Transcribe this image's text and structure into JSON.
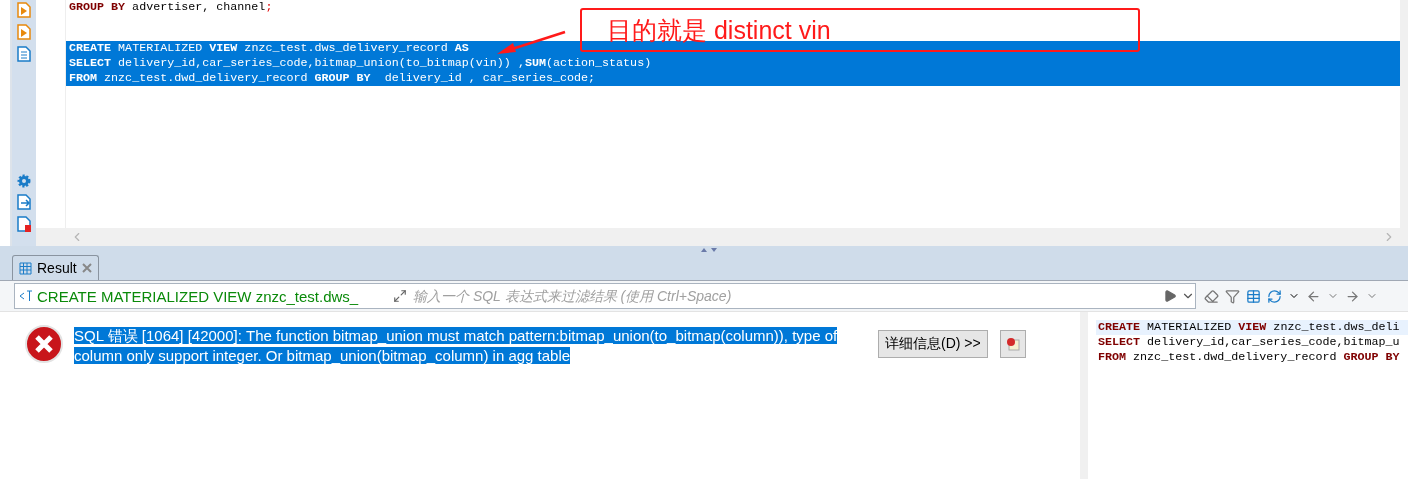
{
  "editor": {
    "previous_lines": [
      {
        "selected": false,
        "tokens": [
          {
            "kind": "keyword",
            "text": "GROUP BY"
          },
          {
            "kind": "text",
            "text": " advertiser, channel"
          },
          {
            "kind": "punct",
            "text": ";"
          }
        ]
      }
    ],
    "lines": [
      {
        "selected": true,
        "tokens": [
          {
            "kind": "keyword",
            "text": "CREATE"
          },
          {
            "kind": "text",
            "text": " MATERIALIZED "
          },
          {
            "kind": "keyword",
            "text": "VIEW"
          },
          {
            "kind": "text",
            "text": " znzc_test.dws_delivery_record "
          },
          {
            "kind": "keyword",
            "text": "AS"
          }
        ]
      },
      {
        "selected": true,
        "tokens": [
          {
            "kind": "keyword",
            "text": "SELECT"
          },
          {
            "kind": "text",
            "text": " delivery_id,car_series_code,bitmap_union(to_bitmap(vin)) ,"
          },
          {
            "kind": "keyword",
            "text": "SUM"
          },
          {
            "kind": "text",
            "text": "(action_status)"
          }
        ]
      },
      {
        "selected": true,
        "tokens": [
          {
            "kind": "keyword",
            "text": "FROM"
          },
          {
            "kind": "text",
            "text": " znzc_test.dwd_delivery_record "
          },
          {
            "kind": "keyword",
            "text": "GROUP BY"
          },
          {
            "kind": "text",
            "text": "  delivery_id , car_series_code;"
          }
        ]
      }
    ]
  },
  "annotation": {
    "text": "目的就是 distinct vin"
  },
  "results": {
    "tab": {
      "label": "Result",
      "selected": true
    },
    "filter": {
      "query": "CREATE MATERIALIZED VIEW znzc_test.dws_",
      "placeholder": "输入一个 SQL 表达式来过滤结果 (使用 Ctrl+Space)"
    },
    "error": {
      "message": "SQL 错误 [1064] [42000]: The function bitmap_union must match pattern:bitmap_union(to_bitmap(column)), type of column only support integer. Or bitmap_union(bitmap_column) in agg table",
      "details_button": "详细信息(D) >>"
    },
    "query_lines": [
      {
        "selected": true,
        "tokens": [
          {
            "kind": "keyword",
            "text": "CREATE"
          },
          {
            "kind": "text",
            "text": " MATERIALIZED "
          },
          {
            "kind": "keyword",
            "text": "VIEW"
          },
          {
            "kind": "text",
            "text": " znzc_test.dws_deli"
          }
        ]
      },
      {
        "selected": false,
        "tokens": [
          {
            "kind": "keyword",
            "text": "SELECT"
          },
          {
            "kind": "text",
            "text": " delivery_id,car_series_code,bitmap_u"
          }
        ]
      },
      {
        "selected": false,
        "tokens": [
          {
            "kind": "keyword",
            "text": "FROM"
          },
          {
            "kind": "text",
            "text": " znzc_test.dwd_delivery_record "
          },
          {
            "kind": "keyword",
            "text": "GROUP BY"
          }
        ]
      }
    ]
  }
}
